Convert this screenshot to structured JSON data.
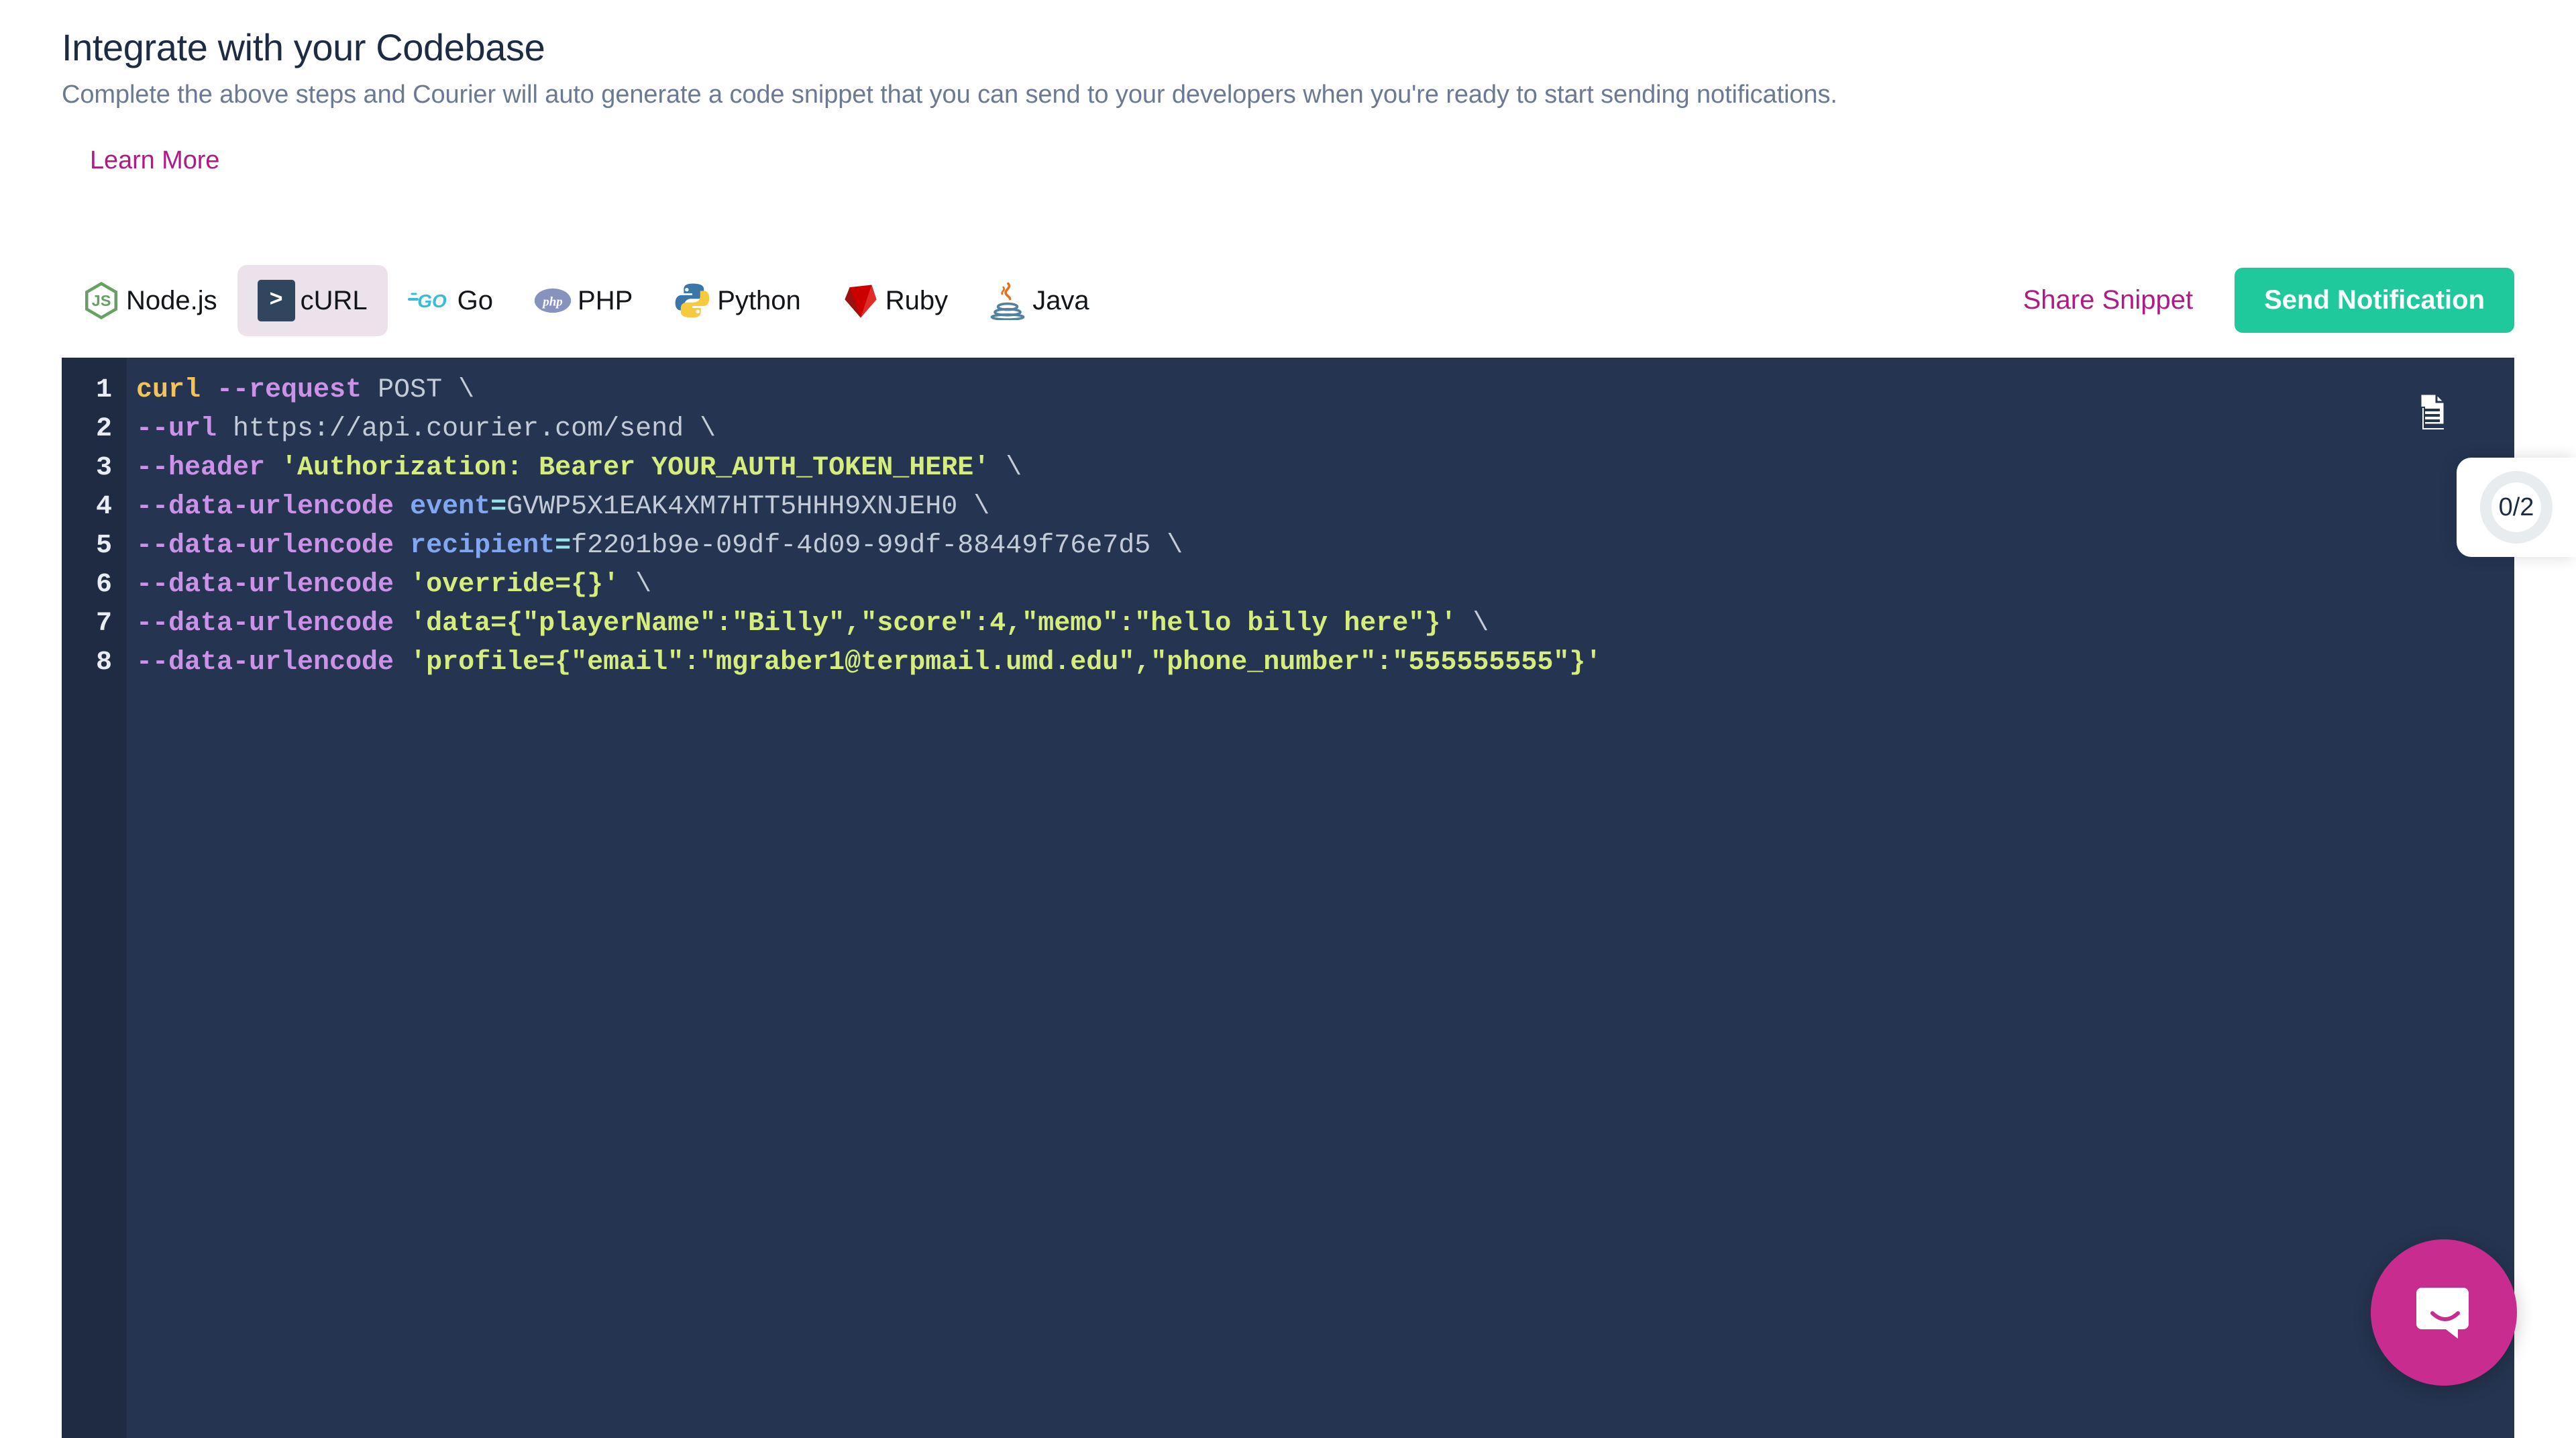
{
  "header": {
    "title": "Integrate with your Codebase",
    "subtitle": "Complete the above steps and Courier will auto generate a code snippet that you can send to your developers when you're ready to start sending notifications.",
    "learn_more_label": "Learn More"
  },
  "toolbar": {
    "tabs": [
      {
        "id": "nodejs",
        "label": "Node.js",
        "icon": "nodejs-logo-icon",
        "active": false
      },
      {
        "id": "curl",
        "label": "cURL",
        "icon": "curl-prompt-icon",
        "active": true
      },
      {
        "id": "go",
        "label": "Go",
        "icon": "go-gopher-logo-icon",
        "active": false
      },
      {
        "id": "php",
        "label": "PHP",
        "icon": "php-logo-icon",
        "active": false
      },
      {
        "id": "python",
        "label": "Python",
        "icon": "python-logo-icon",
        "active": false
      },
      {
        "id": "ruby",
        "label": "Ruby",
        "icon": "ruby-gem-logo-icon",
        "active": false
      },
      {
        "id": "java",
        "label": "Java",
        "icon": "java-coffee-cup-logo-icon",
        "active": false
      }
    ],
    "share_snippet_label": "Share Snippet",
    "send_notification_label": "Send Notification",
    "curl_prompt_glyph": ">"
  },
  "code": {
    "language": "cURL",
    "copy_icon": "copy-document-icon",
    "lines": [
      {
        "n": "1",
        "tokens": [
          {
            "t": "curl",
            "c": "t-cmd"
          },
          {
            "t": " ",
            "c": "t-plain"
          },
          {
            "t": "--request",
            "c": "t-flag"
          },
          {
            "t": " POST \\",
            "c": "t-plain"
          }
        ]
      },
      {
        "n": "2",
        "tokens": [
          {
            "t": "--url",
            "c": "t-flag"
          },
          {
            "t": " https://api.courier.com/send \\",
            "c": "t-plain"
          }
        ]
      },
      {
        "n": "3",
        "tokens": [
          {
            "t": "--header",
            "c": "t-flag"
          },
          {
            "t": " ",
            "c": "t-plain"
          },
          {
            "t": "'Authorization: Bearer YOUR_AUTH_TOKEN_HERE'",
            "c": "t-str"
          },
          {
            "t": " \\",
            "c": "t-plain"
          }
        ]
      },
      {
        "n": "4",
        "tokens": [
          {
            "t": "--data-urlencode",
            "c": "t-flag"
          },
          {
            "t": " ",
            "c": "t-plain"
          },
          {
            "t": "event",
            "c": "t-key"
          },
          {
            "t": "=",
            "c": "t-op"
          },
          {
            "t": "GVWP5X1EAK4XM7HTT5HHH9XNJEH0 \\",
            "c": "t-plain"
          }
        ]
      },
      {
        "n": "5",
        "tokens": [
          {
            "t": "--data-urlencode",
            "c": "t-flag"
          },
          {
            "t": " ",
            "c": "t-plain"
          },
          {
            "t": "recipient",
            "c": "t-key"
          },
          {
            "t": "=",
            "c": "t-op"
          },
          {
            "t": "f2201b9e-09df-4d09-99df-88449f76e7d5 \\",
            "c": "t-plain"
          }
        ]
      },
      {
        "n": "6",
        "tokens": [
          {
            "t": "--data-urlencode",
            "c": "t-flag"
          },
          {
            "t": " ",
            "c": "t-plain"
          },
          {
            "t": "'override={}'",
            "c": "t-str"
          },
          {
            "t": " \\",
            "c": "t-plain"
          }
        ]
      },
      {
        "n": "7",
        "tokens": [
          {
            "t": "--data-urlencode",
            "c": "t-flag"
          },
          {
            "t": " ",
            "c": "t-plain"
          },
          {
            "t": "'data={\"playerName\":\"Billy\",\"score\":4,\"memo\":\"hello billy here\"}'",
            "c": "t-str"
          },
          {
            "t": " \\",
            "c": "t-plain"
          }
        ]
      },
      {
        "n": "8",
        "tokens": [
          {
            "t": "--data-urlencode",
            "c": "t-flag"
          },
          {
            "t": " ",
            "c": "t-plain"
          },
          {
            "t": "'profile={\"email\":\"mgraber1@terpmail.umd.edu\",\"phone_number\":\"555555555\"}'",
            "c": "t-str"
          }
        ]
      }
    ]
  },
  "progress_widget": {
    "label": "0/2",
    "icon": "progress-ring-icon"
  },
  "intercom": {
    "icon": "intercom-chat-bubble-icon",
    "color": "#c72c8e"
  },
  "colors": {
    "accent_pink": "#b01a86",
    "accent_green": "#1fc99b",
    "code_bg": "#253450",
    "gutter_bg": "#1e2b42",
    "title": "#1d2b43",
    "subtitle": "#6b7a92",
    "active_tab_bg": "#ece2eb"
  }
}
